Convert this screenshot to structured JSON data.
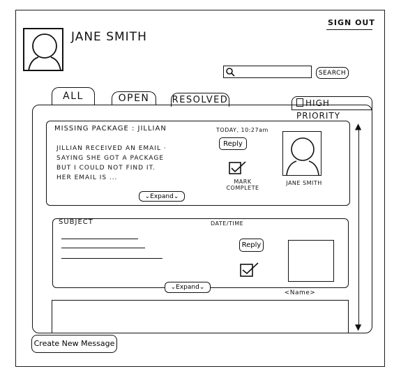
{
  "header": {
    "user_name": "JANE SMITH",
    "sign_out": "SIGN OUT"
  },
  "search": {
    "value": "",
    "button_label": "SEARCH"
  },
  "tabs": [
    {
      "label": "ALL",
      "active": true
    },
    {
      "label": "OPEN",
      "active": false
    },
    {
      "label": "RESOLVED",
      "active": false
    }
  ],
  "filter": {
    "high_priority_label": "HIGH PRIORITY",
    "checked": false
  },
  "messages": [
    {
      "subject": "MISSING PACKAGE : JILLIAN",
      "timestamp": "TODAY, 10:27am",
      "body_lines": [
        "JILLIAN RECEIVED AN EMAIL ·",
        "SAYING SHE GOT A PACKAGE",
        "BUT I COULD NOT FIND IT.",
        "HER EMAIL IS ..."
      ],
      "reply_label": "Reply",
      "mark_complete_label": "MARK COMPLETE",
      "sender": "JANE SMITH",
      "expand_label": "Expand"
    },
    {
      "subject": "SUBJECT",
      "timestamp": "DATE/TIME",
      "reply_label": "Reply",
      "sender": "<Name>",
      "expand_label": "Expand"
    }
  ],
  "footer": {
    "create_label": "Create New Message"
  },
  "icons": {
    "search": "search-icon",
    "scroll_up": "arrow-up-icon",
    "scroll_down": "arrow-down-icon",
    "expand": "chevron-double-down-icon",
    "checkbox": "checkbox-checked-icon"
  }
}
